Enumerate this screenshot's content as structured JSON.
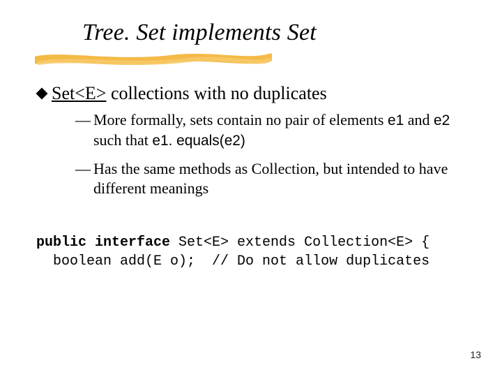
{
  "title": "Tree. Set implements Set",
  "main_bullet": {
    "link": "Set<E>",
    "rest": " collections with no duplicates"
  },
  "sub1": {
    "pre": "More formally, sets contain no pair of elements ",
    "e1": "e1",
    "mid": " and ",
    "e2": "e2",
    "mid2": " such that ",
    "expr": "e1. equals(e2)"
  },
  "sub2": "Has the same methods as Collection, but intended to have different meanings",
  "code": {
    "line1_kw": "public interface",
    "line1_rest": " Set<E> extends Collection<E> {",
    "line2": "  boolean add(E o);  // Do not allow duplicates"
  },
  "page_number": "13"
}
